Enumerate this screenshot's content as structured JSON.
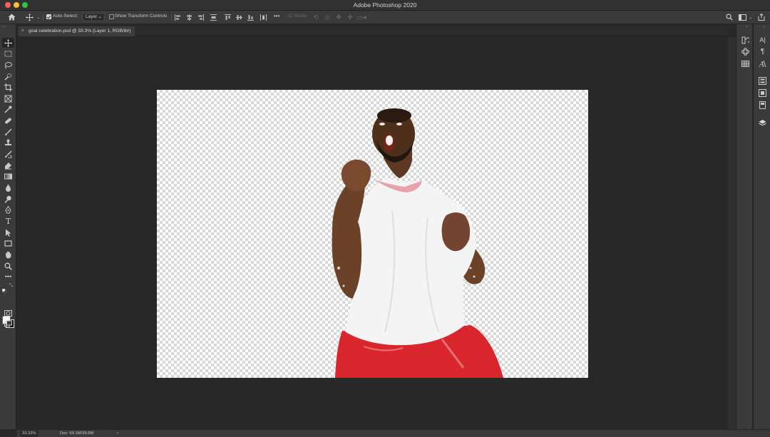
{
  "window": {
    "title": "Adobe Photoshop 2020",
    "traffic_lights": {
      "close": "#fe5f57",
      "minimize": "#febc2e",
      "maximize": "#28c840"
    }
  },
  "options_bar": {
    "home_icon": "home-icon",
    "move_tool_icon": "move-icon",
    "auto_select_label": "Auto-Select:",
    "auto_select_checked": true,
    "auto_select_target": "Layer",
    "show_transform_label": "Show Transform Controls",
    "show_transform_checked": false,
    "mode_3d_label": "3D Mode:",
    "more_label": "•••"
  },
  "document": {
    "tab_title": "goal celebration.psd @ 33.3% (Layer 1, RGB/8#)",
    "close_glyph": "×",
    "canvas_background": "transparent-checkerboard"
  },
  "status_bar": {
    "zoom": "33.33%",
    "doc_info": "Doc: 69.1M/39.8M",
    "arrow": "›"
  },
  "tools": [
    "move-tool",
    "rectangular-marquee-tool",
    "lasso-tool",
    "quick-selection-tool",
    "crop-tool",
    "frame-tool",
    "eyedropper-tool",
    "spot-healing-tool",
    "brush-tool",
    "clone-stamp-tool",
    "history-brush-tool",
    "eraser-tool",
    "gradient-tool",
    "blur-tool",
    "dodge-tool",
    "pen-tool",
    "type-tool",
    "path-selection-tool",
    "rectangle-tool",
    "hand-tool",
    "zoom-tool",
    "edit-toolbar",
    "color-swatches",
    "quick-mask",
    "screen-mode"
  ],
  "type_tool_glyph": "T",
  "char_panel_glyph": "A|",
  "para_panel_glyph": "¶",
  "colors": {
    "foreground": "#ffffff",
    "background": "#000000",
    "accent": "#d8d8d8"
  }
}
